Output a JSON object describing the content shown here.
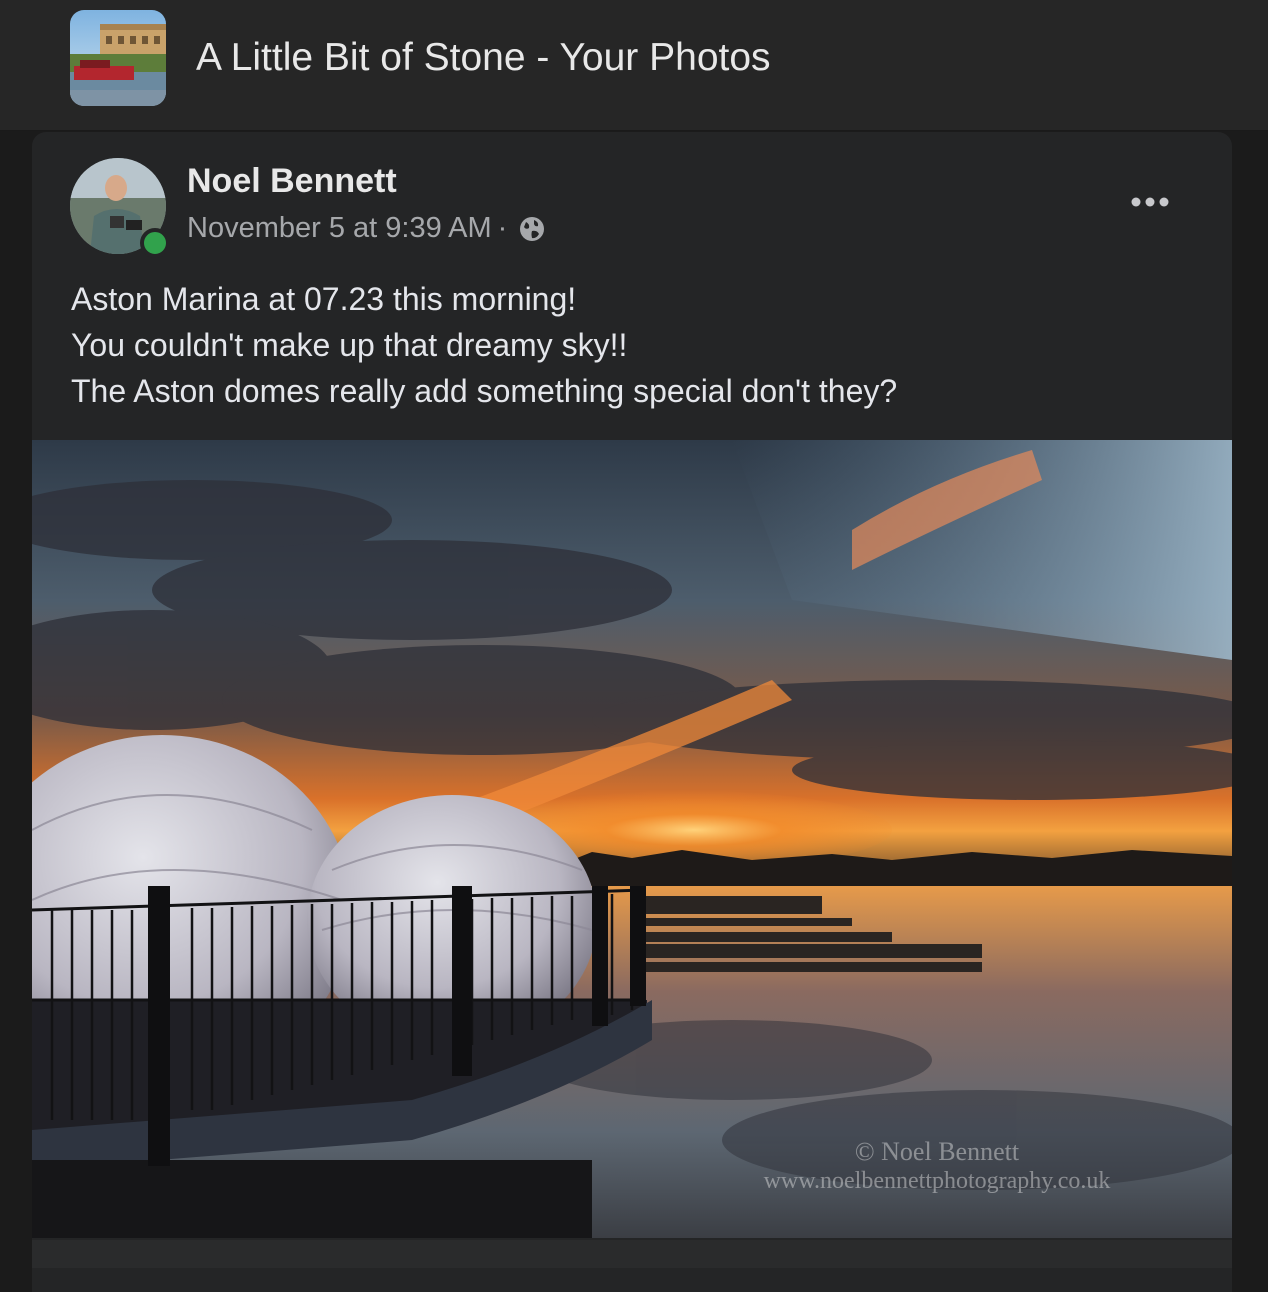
{
  "header": {
    "group_title": "A Little Bit of Stone - Your Photos",
    "group_icon": "group-photo-thumbnail"
  },
  "post": {
    "author": "Noel Bennett",
    "timestamp": "November 5 at 9:39 AM",
    "separator": "·",
    "privacy_icon": "globe-icon",
    "online_status": "online",
    "more_icon": "more-options-icon",
    "text_lines": [
      "Aston Marina at 07.23 this morning!",
      "You couldn't make up that dreamy sky!!",
      "The Aston domes really add something special don't they?"
    ],
    "photo": {
      "watermark_line1": "© Noel Bennett",
      "watermark_line2": "www.noelbennettphotography.co.uk"
    }
  },
  "colors": {
    "background": "#1b1b1b",
    "card": "#242526",
    "text_primary": "#e4e6eb",
    "text_secondary": "#a6a8ab",
    "online": "#31a24c"
  }
}
